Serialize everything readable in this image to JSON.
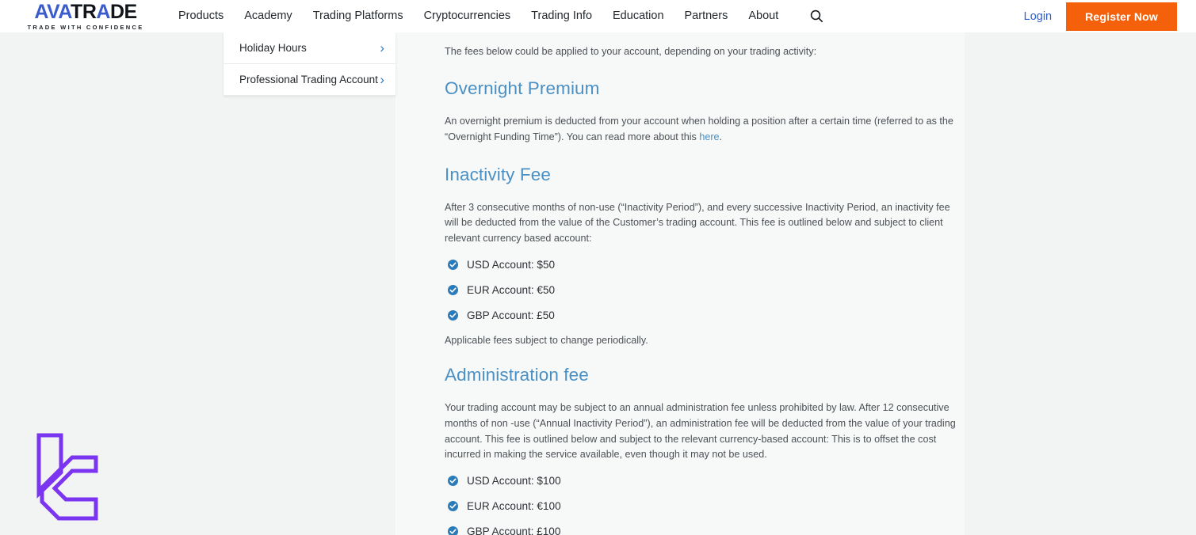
{
  "header": {
    "logo": {
      "part_ava": "AVA",
      "part_t": "TR",
      "part_a2": "A",
      "part_rest": "DE",
      "tagline": "TRADE WITH CONFIDENCE"
    },
    "nav_items": [
      {
        "label": "Products"
      },
      {
        "label": "Academy"
      },
      {
        "label": "Trading Platforms"
      },
      {
        "label": "Cryptocurrencies"
      },
      {
        "label": "Trading Info"
      },
      {
        "label": "Education"
      },
      {
        "label": "Partners"
      },
      {
        "label": "About"
      }
    ],
    "search_icon": "search-icon",
    "login_label": "Login",
    "register_label": "Register Now",
    "register_color": "#f4610a",
    "login_color": "#2f5fd0"
  },
  "sidebar": {
    "items": [
      {
        "label": "Holiday Hours",
        "icon": "chevron-right-icon"
      },
      {
        "label": "Professional Trading Account",
        "icon": "chevron-right-icon"
      }
    ],
    "chevron_color": "#2f7bbf"
  },
  "main": {
    "intro": "The fees below could be applied to your account, depending on your trading activity:",
    "sections": [
      {
        "heading": "Overnight Premium",
        "paragraph_before_link": "An overnight premium is deducted from your account when holding a position after a certain time (referred to as the “Overnight Funding Time”). You can read more about this ",
        "link_label": "here",
        "paragraph_after_link": "."
      },
      {
        "heading": "Inactivity Fee",
        "paragraph": "After 3 consecutive months of non-use (“Inactivity Period”), and every successive Inactivity Period, an inactivity fee will be deducted from the value of the Customer’s trading account. This fee is outlined below and subject to client relevant currency based account:",
        "items": [
          "USD Account: $50",
          "EUR Account: €50",
          "GBP Account: £50"
        ],
        "note": "Applicable fees subject to change periodically."
      },
      {
        "heading": "Administration fee",
        "paragraph": "Your trading account may be subject to an annual administration fee unless prohibited by law. After 12 consecutive months of non -use (“Annual Inactivity Period”), an administration fee will be deducted from the value of your trading account. This fee is outlined below and subject to the relevant currency-based account: This is to offset the cost incurred in making the service available, even though it may not be used.",
        "items": [
          "USD Account: $100",
          "EUR Account: €100",
          "GBP Account: £100"
        ]
      }
    ],
    "heading_color": "#4a90c4",
    "check_color": "#2b7bb9"
  },
  "watermark": {
    "icon": "lc-monogram-logo",
    "color": "#7b35f0"
  }
}
